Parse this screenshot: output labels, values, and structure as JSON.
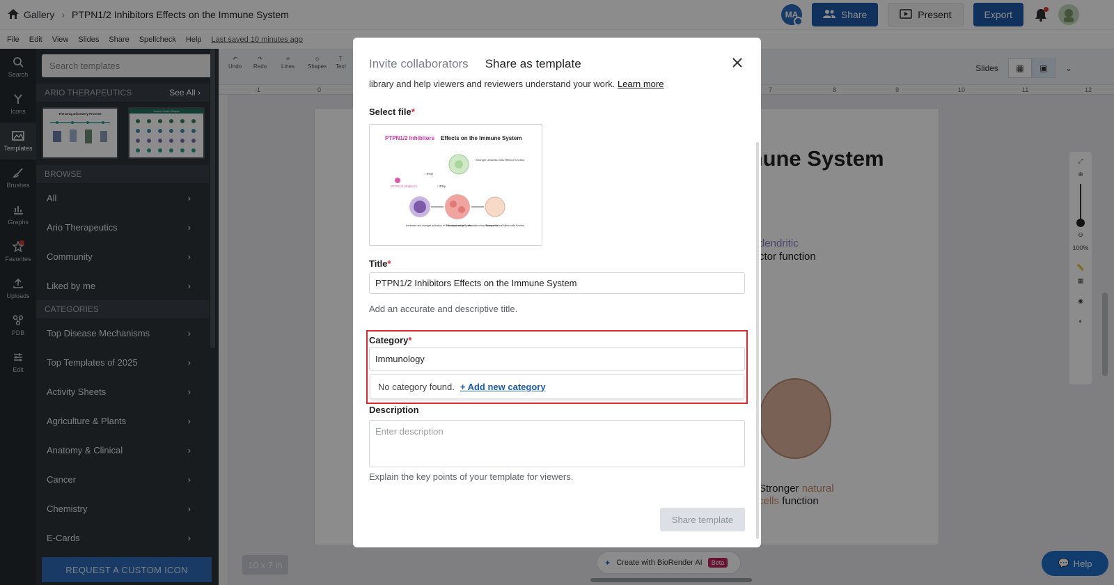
{
  "topbar": {
    "gallery": "Gallery",
    "doc_title": "PTPN1/2 Inhibitors Effects on the Immune System",
    "avatar": "MA",
    "share": "Share",
    "present": "Present",
    "export": "Export"
  },
  "menu": [
    "File",
    "Edit",
    "View",
    "Slides",
    "Share",
    "Spellcheck",
    "Help"
  ],
  "saved": "Last saved 10 minutes ago",
  "rail": [
    {
      "label": "Search",
      "icon": "search-icon"
    },
    {
      "label": "Icons",
      "icon": "icons-icon"
    },
    {
      "label": "Templates",
      "icon": "templates-icon"
    },
    {
      "label": "Brushes",
      "icon": "brush-icon"
    },
    {
      "label": "Graphs",
      "icon": "graph-icon"
    },
    {
      "label": "Favorites",
      "icon": "star-icon"
    },
    {
      "label": "Uploads",
      "icon": "upload-icon"
    },
    {
      "label": "PDB",
      "icon": "pdb-icon"
    },
    {
      "label": "Edit",
      "icon": "sliders-icon"
    }
  ],
  "panel": {
    "search_placeholder": "Search templates",
    "org_header": "ARIO THERAPEUTICS",
    "see_all": "See All",
    "thumb1": "The Drug Discovery Process",
    "thumb2": "Generic Protein Shapes",
    "browse_header": "BROWSE",
    "browse": [
      "All",
      "Ario Therapeutics",
      "Community",
      "Liked by me"
    ],
    "categories_header": "CATEGORIES",
    "categories": [
      "Top Disease Mechanisms",
      "Top Templates of 2025",
      "Activity Sheets",
      "Agriculture & Plants",
      "Anatomy & Clinical",
      "Cancer",
      "Chemistry",
      "E-Cards"
    ],
    "request_btn": "REQUEST A CUSTOM ICON"
  },
  "toolbar": {
    "undo": "Undo",
    "redo": "Redo",
    "lines": "Lines",
    "shapes": "Shapes",
    "text": "Text",
    "slides": "Slides"
  },
  "ruler": {
    "ticks": [
      "-1",
      "0",
      "7",
      "8",
      "9",
      "10",
      "11",
      "12"
    ]
  },
  "slide": {
    "title_fragment": "mune System",
    "dendritic": "dendritic",
    "effector": "ctor function",
    "stronger": "Stronger",
    "natural": "natural",
    "cells": "ers cells",
    "function": "function"
  },
  "zoom": "100%",
  "size_badge": "10 x 7 in",
  "ai": {
    "label": "Create with BioRender AI",
    "badge": "Beta"
  },
  "help": "Help",
  "modal": {
    "tab_invite": "Invite collaborators",
    "tab_share": "Share as template",
    "intro": "library and help viewers and reviewers understand your work.",
    "learn_more": "Learn more",
    "select_file_label": "Select file",
    "file_preview": {
      "title_pink": "PTPN1/2 Inhibitors",
      "title_rest": "Effects on the Immune System",
      "inhib": "PTPN1/2 Inhibitors",
      "ifn1": "↑ IFNγ",
      "ifn2": "↑ IFNγ",
      "dc_label": "Stronger dendritic cells effector function",
      "cap1": "Increased and stronger activation of IFNγ response in T cells",
      "cap2": "Increased antigen presentation from tumor cells",
      "cap3": "Stronger natural killers cells function"
    },
    "title_label": "Title",
    "title_value": "PTPN1/2 Inhibitors Effects on the Immune System",
    "title_hint": "Add an accurate and descriptive title.",
    "category_label": "Category",
    "category_value": "Immunology",
    "no_category": "No category found.",
    "add_category": "+ Add new category",
    "description_label": "Description",
    "description_placeholder": "Enter description",
    "description_hint": "Explain the key points of your template for viewers.",
    "share_button": "Share template"
  },
  "colors": {
    "primary": "#1e5aa8",
    "highlight": "#e0262f",
    "sidebar": "#2f3338",
    "required": "#d9232e"
  }
}
